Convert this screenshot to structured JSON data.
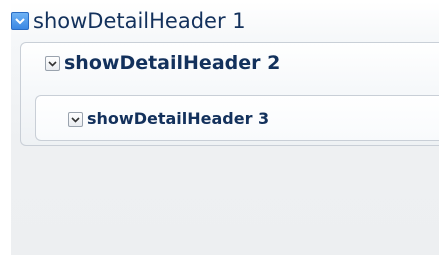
{
  "headers": {
    "level1": {
      "label": "showDetailHeader 1",
      "icon": "disclosure-toggle-icon",
      "expanded": true
    },
    "level2": {
      "label": "showDetailHeader 2",
      "icon": "disclosure-toggle-icon",
      "expanded": true
    },
    "level3": {
      "label": "showDetailHeader 3",
      "icon": "disclosure-toggle-icon",
      "expanded": true
    }
  },
  "colors": {
    "title_text": "#13315c",
    "toggle_active": "#3b87e3",
    "border": "#c9cfd7"
  }
}
